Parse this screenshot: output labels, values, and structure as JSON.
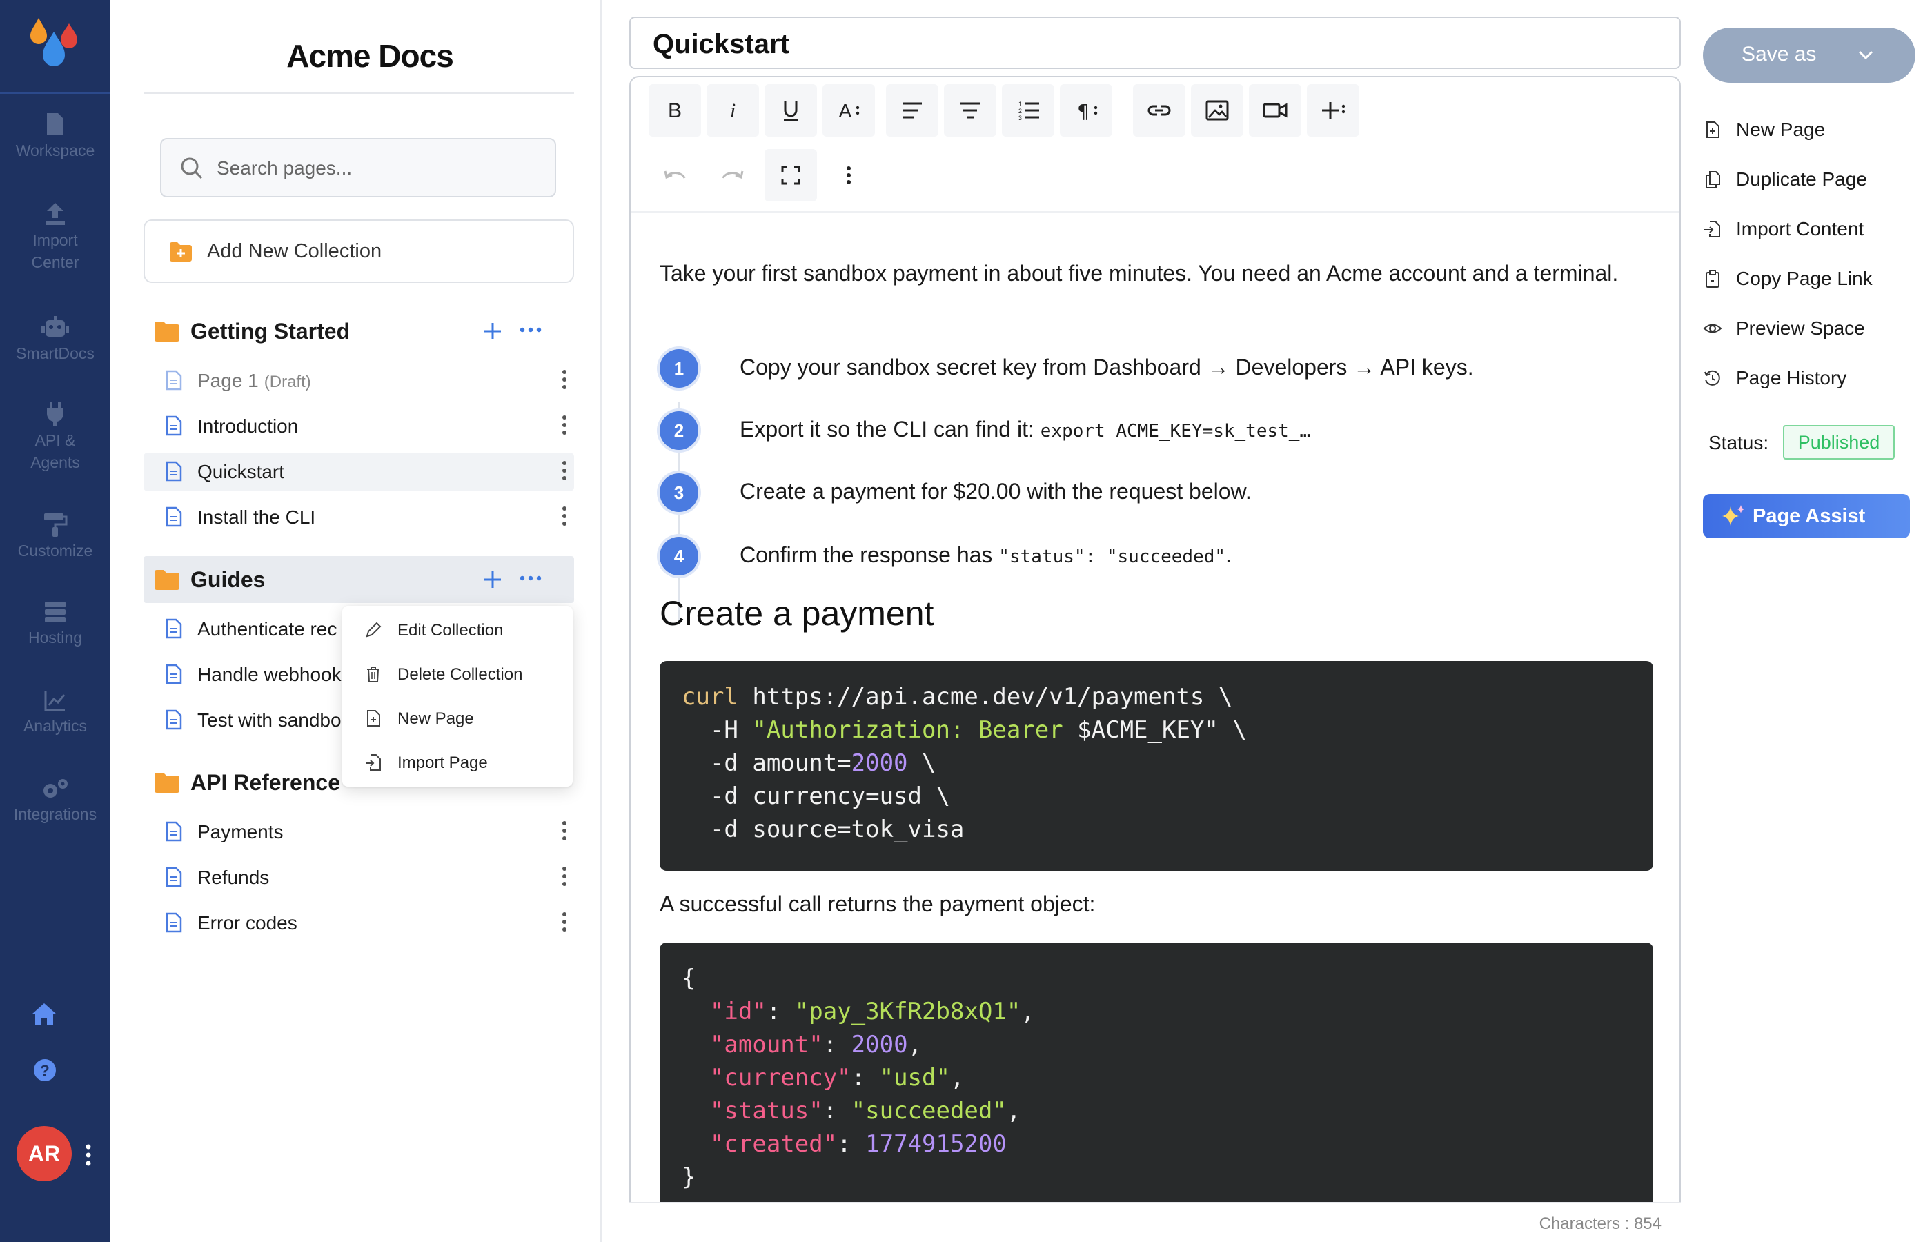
{
  "colors": {
    "rail_bg": "#1e3261",
    "accent": "#4a7be0",
    "published": "#2fbf63",
    "code_bg": "#282a2b"
  },
  "nav": {
    "items": [
      {
        "label": "Workspace",
        "icon": "file-icon"
      },
      {
        "label": "Import Center",
        "icon": "upload-icon"
      },
      {
        "label": "SmartDocs",
        "icon": "robot-icon"
      },
      {
        "label": "API & Agents",
        "icon": "plug-icon"
      },
      {
        "label": "Customize",
        "icon": "paint-roller-icon"
      },
      {
        "label": "Hosting",
        "icon": "server-icon"
      },
      {
        "label": "Analytics",
        "icon": "chart-icon"
      },
      {
        "label": "Integrations",
        "icon": "gears-icon"
      }
    ],
    "avatar_initials": "AR"
  },
  "sidebar": {
    "title": "Acme Docs",
    "search_placeholder": "Search pages...",
    "add_collection": "Add New Collection",
    "collections": [
      {
        "name": "Getting Started",
        "pages": [
          {
            "label": "Page 1",
            "draft": "(Draft)"
          },
          {
            "label": "Introduction"
          },
          {
            "label": "Quickstart"
          },
          {
            "label": "Install the CLI"
          }
        ]
      },
      {
        "name": "Guides",
        "pages": [
          {
            "label": "Authenticate rec"
          },
          {
            "label": "Handle webhook"
          },
          {
            "label": "Test with sandbo"
          }
        ]
      },
      {
        "name": "API Reference",
        "pages": [
          {
            "label": "Payments"
          },
          {
            "label": "Refunds"
          },
          {
            "label": "Error codes"
          }
        ]
      }
    ],
    "context_menu": [
      "Edit Collection",
      "Delete Collection",
      "New Page",
      "Import Page"
    ]
  },
  "editor": {
    "title": "Quickstart",
    "intro": "Take your first sandbox payment in about five minutes. You need an Acme account and a terminal.",
    "steps": [
      {
        "num": "1",
        "text": "Copy your sandbox secret key from Dashboard → Developers → API keys.",
        "code": ""
      },
      {
        "num": "2",
        "text": "Export it so the CLI can find it: ",
        "code": "export ACME_KEY=sk_test_…"
      },
      {
        "num": "3",
        "text": "Create a payment for $20.00 with the request below.",
        "code": ""
      },
      {
        "num": "4",
        "text": "Confirm the response has ",
        "code": "\"status\": \"succeeded\"",
        "suffix": "."
      }
    ],
    "heading": "Create a payment",
    "curl": {
      "cmd": "curl",
      "url": " https://api.acme.dev/v1/payments \\",
      "flag_h": "  -H ",
      "auth": "\"Authorization: Bearer",
      "key": " $ACME_KEY\"",
      "bs": " \\",
      "amount_pre": "  -d amount=",
      "amount": "2000",
      "currency": "  -d currency=usd \\",
      "source": "  -d source=tok_visa"
    },
    "para": "A successful call returns the payment object:",
    "json_fields": [
      {
        "key": "\"id\"",
        "value": "\"pay_3KfR2b8xQ1\"",
        "kind": "string"
      },
      {
        "key": "\"amount\"",
        "value": "2000",
        "kind": "number"
      },
      {
        "key": "\"currency\"",
        "value": "\"usd\"",
        "kind": "string"
      },
      {
        "key": "\"status\"",
        "value": "\"succeeded\"",
        "kind": "string"
      },
      {
        "key": "\"created\"",
        "value": "1774915200",
        "kind": "number"
      }
    ],
    "char_count": "Characters : 854"
  },
  "actions": {
    "save_as": "Save as",
    "items": [
      {
        "label": "New Page",
        "icon": "new-page-icon"
      },
      {
        "label": "Duplicate Page",
        "icon": "duplicate-icon"
      },
      {
        "label": "Import Content",
        "icon": "import-icon"
      },
      {
        "label": "Copy Page Link",
        "icon": "clipboard-icon"
      },
      {
        "label": "Preview Space",
        "icon": "eye-icon"
      },
      {
        "label": "Page History",
        "icon": "history-icon"
      }
    ],
    "status_label": "Status:",
    "status_value": "Published",
    "page_assist": "Page Assist"
  }
}
